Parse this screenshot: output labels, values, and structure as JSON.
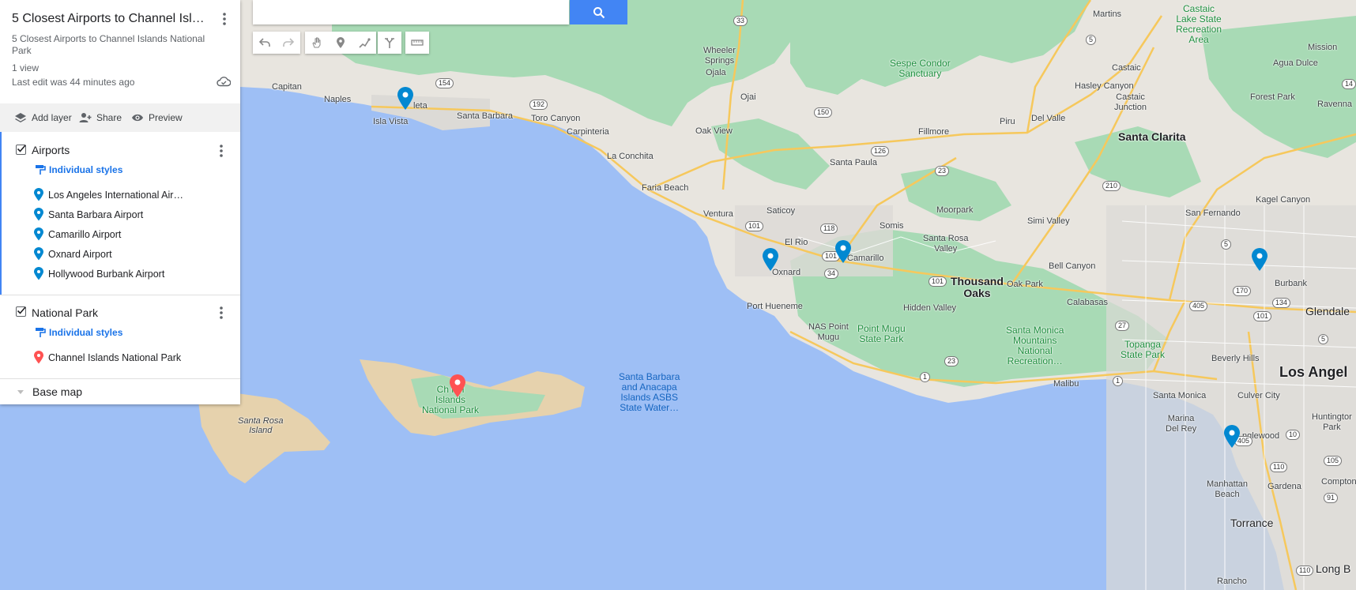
{
  "panel": {
    "title": "5 Closest Airports to Channel Isla…",
    "description": "5 Closest Airports to Channel Islands National Park",
    "views": "1 view",
    "last_edit": "Last edit was 44 minutes ago",
    "actions": {
      "add_layer": "Add layer",
      "share": "Share",
      "preview": "Preview"
    },
    "layers": [
      {
        "name": "Airports",
        "styles_label": "Individual styles",
        "pin_color": "#0288d1",
        "items": [
          "Los Angeles International Air…",
          "Santa Barbara Airport",
          "Camarillo Airport",
          "Oxnard Airport",
          "Hollywood Burbank Airport"
        ]
      },
      {
        "name": "National Park",
        "styles_label": "Individual styles",
        "pin_color": "#ff5252",
        "items": [
          "Channel Islands National Park"
        ]
      }
    ],
    "base_map": "Base map"
  },
  "search": {
    "placeholder": ""
  },
  "map": {
    "colors": {
      "water": "#9ebff5",
      "land": "#e8e5df",
      "park": "#a8dab5",
      "island": "#e6d2ad",
      "road": "#f6c85c"
    },
    "labels": {
      "martins": "Martins",
      "castaic_lake": "Castaic\nLake State\nRecreation\nArea",
      "mission": "Mission",
      "wheeler": "Wheeler\nSprings",
      "ojala": "Ojala",
      "sespe": "Sespe Condor\nSanctuary",
      "castaic": "Castaic",
      "agua_dulce": "Agua Dulce",
      "capitan": "Capitan",
      "naples": "Naples",
      "goleta": "leta",
      "isla_vista": "Isla Vista",
      "santa_barbara": "Santa Barbara",
      "toro_canyon": "Toro Canyon",
      "ojai": "Ojai",
      "hasley": "Hasley Canyon",
      "forest_park": "Forest Park",
      "ravenna": "Ravenna",
      "carpinteria": "Carpinteria",
      "oak_view": "Oak View",
      "fillmore": "Fillmore",
      "piru": "Piru",
      "del_valle": "Del Valle",
      "castaic_junction": "Castaic\nJunction",
      "santa_clarita": "Santa Clarita",
      "la_conchita": "La Conchita",
      "santa_paula": "Santa Paula",
      "faria_beach": "Faria Beach",
      "kagel": "Kagel Canyon",
      "ventura": "Ventura",
      "saticoy": "Saticoy",
      "moorpark": "Moorpark",
      "san_fernando": "San Fernando",
      "simi_valley": "Simi Valley",
      "el_rio": "El Rio",
      "somis": "Somis",
      "santa_rosa_valley": "Santa Rosa\nValley",
      "camarillo": "Camarillo",
      "oxnard": "Oxnard",
      "thousand_oaks": "Thousand\nOaks",
      "oak_park": "Oak Park",
      "bell_canyon": "Bell Canyon",
      "burbank": "Burbank",
      "glendale": "Glendale",
      "port_hueneme": "Port Hueneme",
      "hidden_valley": "Hidden Valley",
      "calabasas": "Calabasas",
      "nas": "NAS Point\nMugu",
      "point_mugu": "Point Mugu\nState Park",
      "santa_monica_mtns": "Santa Monica\nMountains\nNational\nRecreation…",
      "topanga": "Topanga\nState Park",
      "beverly_hills": "Beverly Hills",
      "los_angeles": "Los Angel",
      "malibu": "Malibu",
      "santa_monica": "Santa Monica",
      "culver": "Culver City",
      "marina": "Marina\nDel Rey",
      "inglewood": "nglewood",
      "huntington": "Huntingtor\nPark",
      "channel": "Ch   nel\nIslands\nNational Park",
      "sb_anacapa": "Santa Barbara\nand Anacapa\nIslands ASBS\nState Water…",
      "santa_rosa_island": "Santa Rosa\nIsland",
      "manhattan": "Manhattan\nBeach",
      "gardena": "Gardena",
      "compton": "Compton",
      "torrance": "Torrance",
      "rancho": "Rancho",
      "long_beach": "Long B"
    },
    "shields": [
      "33",
      "5",
      "14",
      "154",
      "192",
      "150",
      "126",
      "23",
      "210",
      "101",
      "118",
      "5",
      "101",
      "34",
      "101",
      "170",
      "134",
      "405",
      "27",
      "101",
      "1",
      "1",
      "23",
      "5",
      "405",
      "10",
      "110",
      "105",
      "91",
      "110"
    ]
  }
}
